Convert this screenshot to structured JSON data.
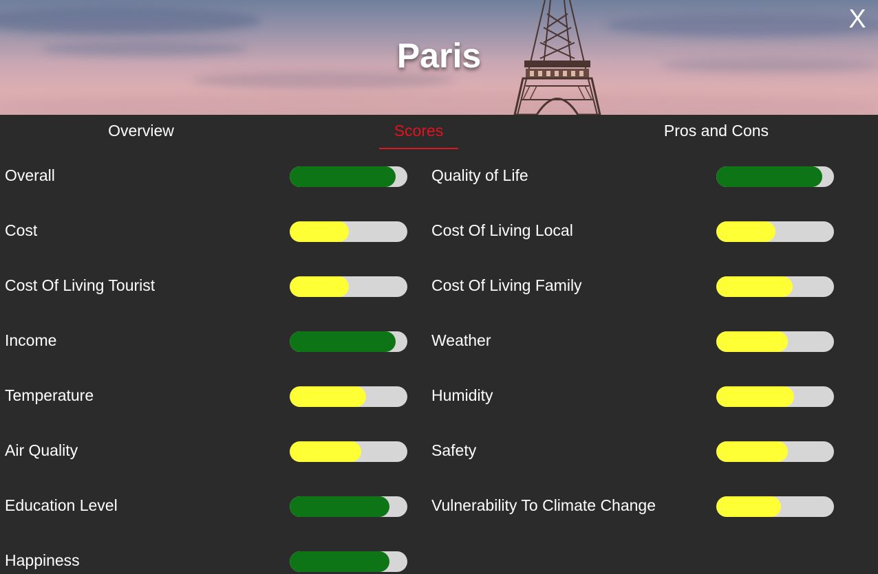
{
  "header": {
    "title": "Paris",
    "close_label": "X"
  },
  "tabs": [
    {
      "label": "Overview",
      "active": false
    },
    {
      "label": "Scores",
      "active": true
    },
    {
      "label": "Pros and Cons",
      "active": false
    }
  ],
  "colors": {
    "active_tab": "#e0141e",
    "high_score": "#0e7517",
    "mid_score": "#ffff35",
    "track": "#d6d6d6",
    "background": "#2b2b2b"
  },
  "scores": {
    "left": [
      {
        "label": "Overall",
        "value": 0.9,
        "level": "high"
      },
      {
        "label": "Cost",
        "value": 0.5,
        "level": "mid"
      },
      {
        "label": "Cost Of Living Tourist",
        "value": 0.5,
        "level": "mid"
      },
      {
        "label": "Income",
        "value": 0.9,
        "level": "high"
      },
      {
        "label": "Temperature",
        "value": 0.65,
        "level": "mid"
      },
      {
        "label": "Air Quality",
        "value": 0.61,
        "level": "mid"
      },
      {
        "label": "Education Level",
        "value": 0.85,
        "level": "high"
      },
      {
        "label": "Happiness",
        "value": 0.85,
        "level": "high"
      }
    ],
    "right": [
      {
        "label": "Quality of Life",
        "value": 0.9,
        "level": "high"
      },
      {
        "label": "Cost Of Living Local",
        "value": 0.5,
        "level": "mid"
      },
      {
        "label": "Cost Of Living Family",
        "value": 0.65,
        "level": "mid"
      },
      {
        "label": "Weather",
        "value": 0.61,
        "level": "mid"
      },
      {
        "label": "Humidity",
        "value": 0.66,
        "level": "mid"
      },
      {
        "label": "Safety",
        "value": 0.61,
        "level": "mid"
      },
      {
        "label": "Vulnerability To Climate Change",
        "value": 0.55,
        "level": "mid"
      }
    ]
  }
}
